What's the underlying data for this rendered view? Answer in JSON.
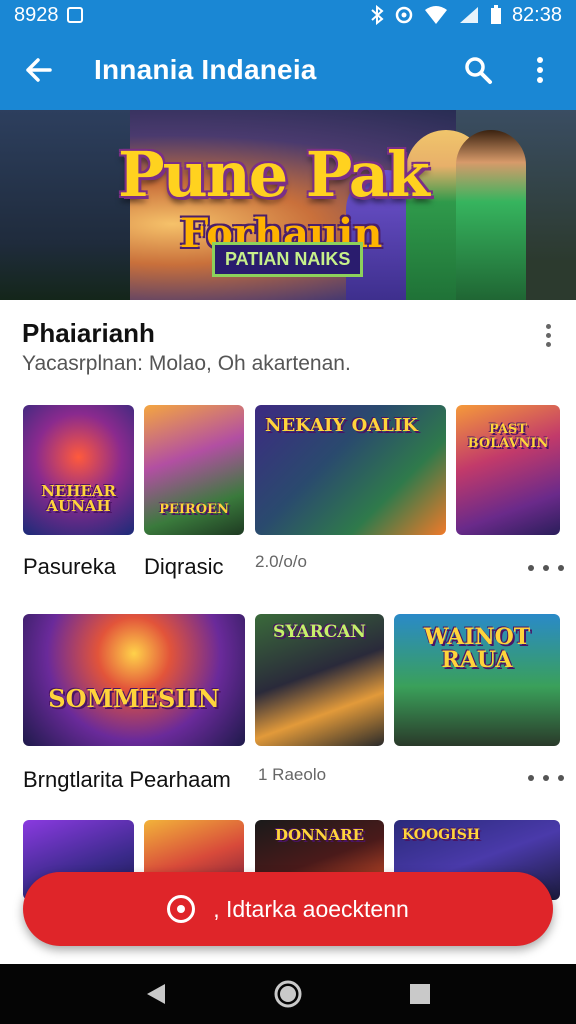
{
  "status_bar": {
    "left_time": "8928",
    "right_time": "82:38"
  },
  "app_bar": {
    "title": "Innania Indaneia"
  },
  "hero": {
    "logo_line1": "Pune Pak",
    "logo_line2": "Forhauin",
    "banner": "PATIAN NAIKS"
  },
  "section": {
    "title": "Phaiarianh",
    "subtitle": "Yacasrplnan: Molao, Oh akartenan."
  },
  "row1": {
    "labels": [
      "Pasureka",
      "Diqrasic"
    ],
    "meta": "2.0/o/o",
    "cards": [
      {
        "text": "NEHEAR AUNAH"
      },
      {
        "text": "PEIROEN"
      },
      {
        "text": "NEKAIY OALIK"
      },
      {
        "text": "PAST BOLAVNIN"
      }
    ]
  },
  "row2": {
    "label": "Brngtlarita Pearhaam",
    "meta": "1 Raeolo",
    "cards": [
      {
        "text": "SOMMESIIN"
      },
      {
        "text": "SYARCAN"
      },
      {
        "text": "WAINOT RAUA"
      }
    ]
  },
  "row3": {
    "cards": [
      {
        "text": ""
      },
      {
        "text": ""
      },
      {
        "text": "DONNARE"
      },
      {
        "text": "KOOGISH"
      }
    ]
  },
  "fab": {
    "label": ", Idtarka aoecktenn"
  },
  "colors": {
    "primary": "#1a87d4",
    "accent": "#df2529"
  }
}
